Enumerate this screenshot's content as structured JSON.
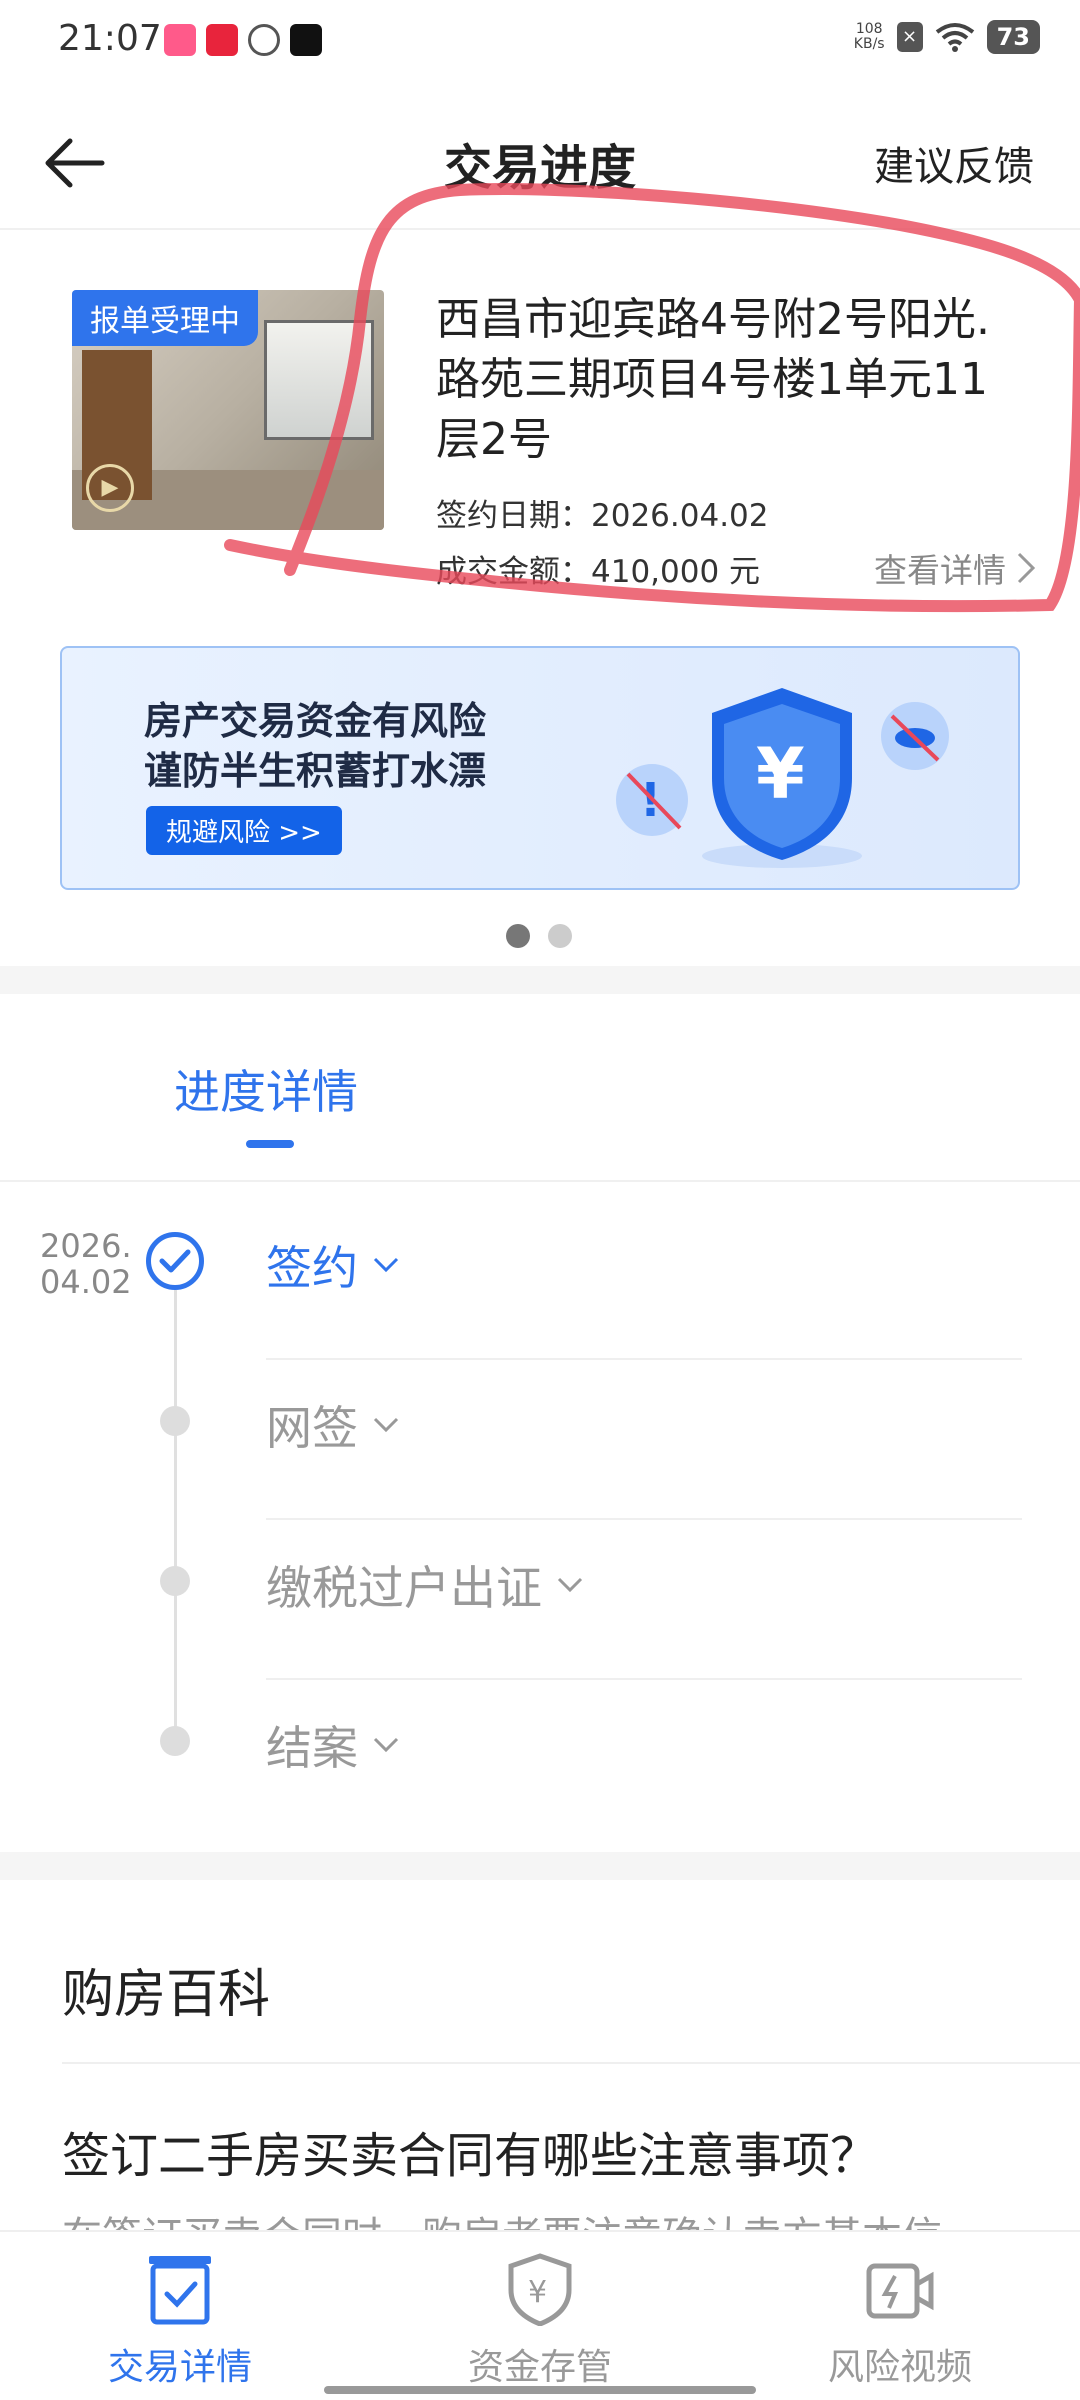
{
  "status_bar": {
    "time": "21:07",
    "net_speed_value": "108",
    "net_speed_unit": "KB/s",
    "battery": "73"
  },
  "header": {
    "title": "交易进度",
    "feedback": "建议反馈"
  },
  "property": {
    "badge": "报单受理中",
    "address": "西昌市迎宾路4号附2号阳光.路苑三期项目4号楼1单元11层2号",
    "sign_date": "签约日期：2026.04.02",
    "amount": "成交金额：410,000 元",
    "detail_link": "查看详情"
  },
  "banner": {
    "line1": "房产交易资金有风险",
    "line2": "谨防半生积蓄打水漂",
    "button": "规避风险 >>",
    "page_count": 2,
    "active_page": 1
  },
  "progress": {
    "tab": "进度详情",
    "date_line1": "2026.",
    "date_line2": "04.02",
    "steps": [
      {
        "label": "签约",
        "done": true
      },
      {
        "label": "网签",
        "done": false
      },
      {
        "label": "缴税过户出证",
        "done": false
      },
      {
        "label": "结案",
        "done": false
      }
    ]
  },
  "encyclopedia": {
    "title": "购房百科",
    "question": "签订二手房买卖合同有哪些注意事项？",
    "preview": "在签订买卖合同时，购房者要注意确认卖方基本信"
  },
  "bottom_nav": [
    {
      "label": "交易详情",
      "icon": "transaction-detail-icon",
      "active": true
    },
    {
      "label": "资金存管",
      "icon": "fund-custody-shield-icon",
      "active": false
    },
    {
      "label": "风险视频",
      "icon": "risk-video-icon",
      "active": false
    }
  ],
  "colors": {
    "accent": "#2f74ec",
    "annotation": "#e8485a"
  }
}
